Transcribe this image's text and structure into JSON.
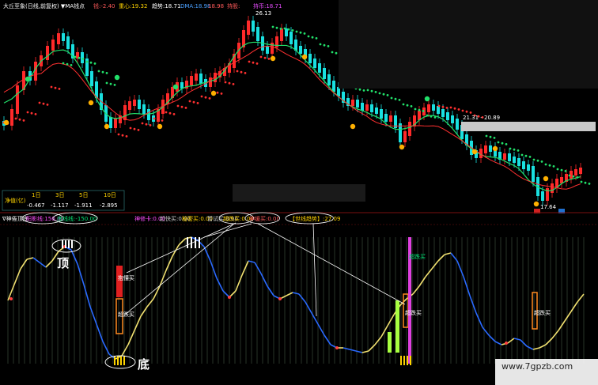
{
  "header": {
    "title": "大丘至象(日线,前复权) ▼MA钱点",
    "items": [
      {
        "label": "钱:",
        "value": "-2.40",
        "color": "#ff5a5a"
      },
      {
        "label": "重心:",
        "value": "19.32",
        "color": "#ffd400"
      },
      {
        "label": "趋势:",
        "value": "18.71",
        "color": "#ffffff"
      },
      {
        "label": "DMA:",
        "value": "18.98",
        "color": "#4aa0ff"
      },
      {
        "label": "",
        "value": "18.98",
        "color": "#ff5a5a"
      },
      {
        "label": "持股:",
        "value": "",
        "color": "#ff5a5a"
      },
      {
        "label": "持币:",
        "value": "18.71",
        "color": "#e84cff"
      }
    ]
  },
  "price_labels": {
    "high": "26.13",
    "low": "17.64",
    "range": "21.31 - 20.89"
  },
  "stats_table": {
    "label": "净值(亿)",
    "headers": [
      "1日",
      "3日",
      "5日",
      "10日"
    ],
    "values": [
      "-0.467",
      "-1.117",
      "-1.911",
      "-2.895"
    ]
  },
  "indicator": {
    "title": "∇神倦顶底",
    "items": [
      {
        "label": "阳影线:",
        "value": "150.00",
        "color": "#ff4dff",
        "circled": true
      },
      {
        "label": "底线线:",
        "value": "-150.00",
        "color": "#00e676",
        "circled": true
      },
      {
        "label": "神修卡:",
        "value": "0.00",
        "color": "#ff4dff",
        "circled": false
      },
      {
        "label": "赶快买:",
        "value": "0.00",
        "color": "#cccccc",
        "circled": false
      },
      {
        "label": "秘密买:",
        "value": "0.00",
        "color": "#ffd400",
        "circled": false
      },
      {
        "label": "暂试买:",
        "value": "0.00",
        "color": "#cccccc",
        "circled": false
      },
      {
        "label": "超跌买:",
        "value": "0.00",
        "color": "#ffd400",
        "circled": true
      },
      {
        "label": "神缓买:",
        "value": "0.00",
        "color": "#ff5a5a",
        "circled": true
      },
      {
        "label": "【世线趋势】:",
        "value": "27.09",
        "color": "#ffd400",
        "circled": true
      }
    ]
  },
  "annotations": {
    "top": "顶",
    "bottom": "底",
    "buy1": "抱懂买",
    "buy2": "超跌买",
    "buy3": "超跌买",
    "buy4": "超跌买",
    "buy5": "超跌买",
    "magenta_buy": "超跌买"
  },
  "watermark": "www.7gpzb.com",
  "colors": {
    "up": "#ff2a2a",
    "down": "#19e0e0",
    "ma_green": "#22e06a",
    "ma_red": "#ff3030",
    "curve_yellow": "#f0e070",
    "curve_blue": "#2a6aff"
  }
}
